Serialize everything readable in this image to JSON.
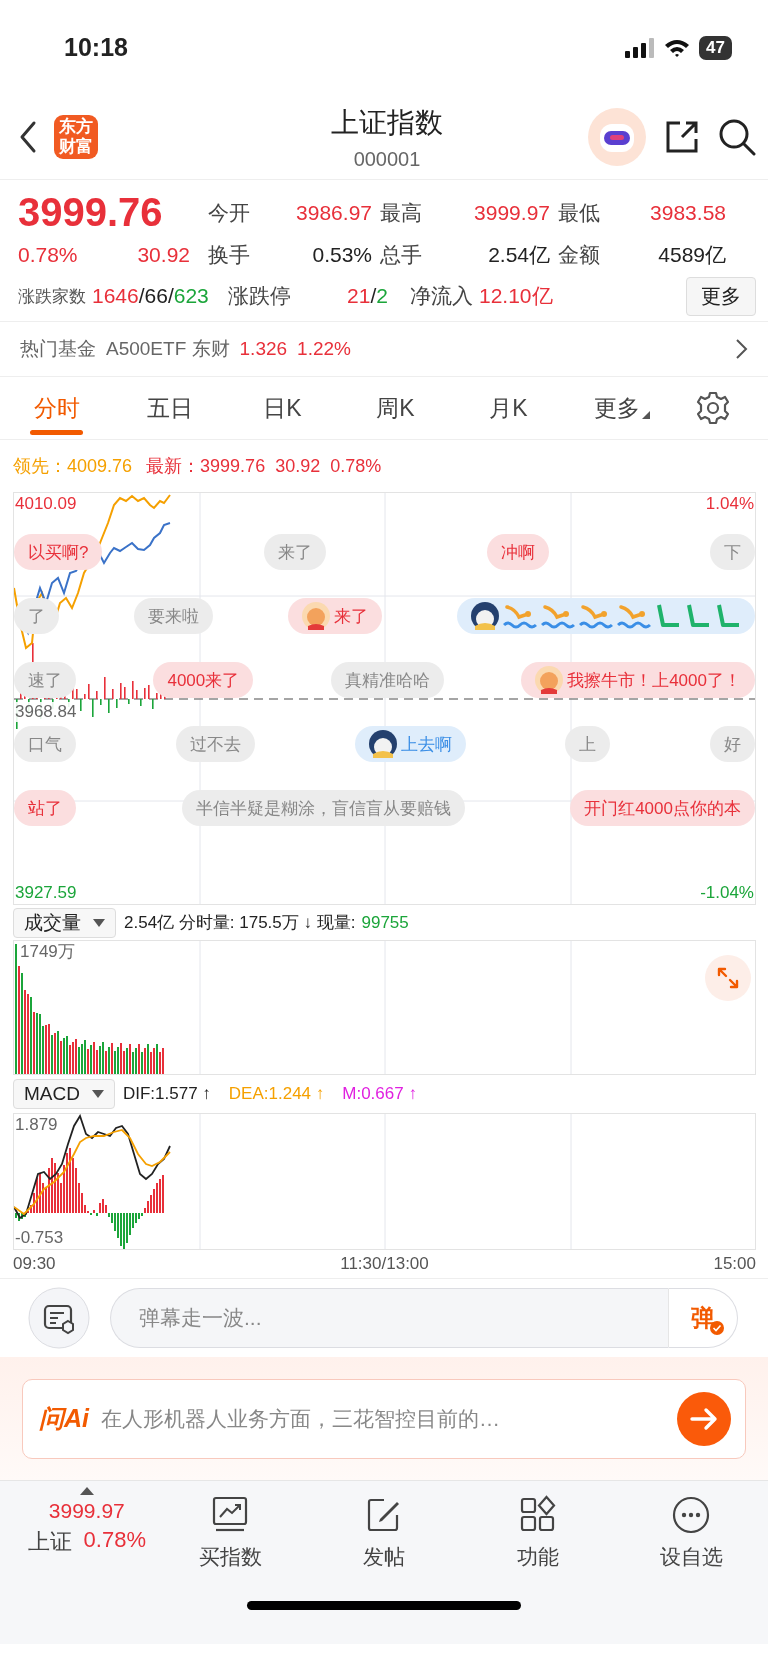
{
  "status_bar": {
    "time": "10:18",
    "battery": "47"
  },
  "header": {
    "logo": "东方财富",
    "title": "上证指数",
    "code": "000001"
  },
  "quote": {
    "price": "3999.76",
    "change_pct": "0.78%",
    "change": "30.92",
    "color": "#e8303a",
    "stats": [
      {
        "label": "今开",
        "value": "3986.97",
        "color": "#e8303a"
      },
      {
        "label": "最高",
        "value": "3999.97",
        "color": "#e8303a"
      },
      {
        "label": "最低",
        "value": "3983.58",
        "color": "#e8303a"
      },
      {
        "label": "换手",
        "value": "0.53%",
        "color": "#222222"
      },
      {
        "label": "总手",
        "value": "2.54亿",
        "color": "#222222"
      },
      {
        "label": "金额",
        "value": "4589亿",
        "color": "#222222"
      }
    ],
    "breadth": {
      "label": "涨跌家数",
      "parts": [
        {
          "text": "1646",
          "color": "#e8303a"
        },
        {
          "text": "/",
          "color": "#222222"
        },
        {
          "text": "66",
          "color": "#222222"
        },
        {
          "text": "/",
          "color": "#222222"
        },
        {
          "text": "623",
          "color": "#1ba53a"
        }
      ]
    },
    "limits": {
      "label": "涨跌停",
      "parts": [
        {
          "text": "21",
          "color": "#e8303a"
        },
        {
          "text": "/",
          "color": "#222222"
        },
        {
          "text": "2",
          "color": "#1ba53a"
        }
      ]
    },
    "inflow": {
      "label": "净流入",
      "value": "12.10亿",
      "color": "#e8303a"
    },
    "more_button": "更多"
  },
  "hot_fund": {
    "label": "热门基金",
    "name": "A500ETF 东财",
    "price": "1.326",
    "change_pct": "1.22%",
    "color": "#e8303a"
  },
  "tabs": [
    {
      "label": "分时",
      "selected": true
    },
    {
      "label": "五日",
      "selected": false
    },
    {
      "label": "日K",
      "selected": false
    },
    {
      "label": "周K",
      "selected": false
    },
    {
      "label": "月K",
      "selected": false
    },
    {
      "label": "更多",
      "selected": false,
      "kind": "menu"
    }
  ],
  "legend": [
    {
      "text": "领先：4009.76",
      "color": "#f5a000"
    },
    {
      "text": "最新：3999.76  30.92  0.78%",
      "color": "#e8303a"
    }
  ],
  "price_chart": {
    "labels": [
      {
        "text": "4010.09",
        "kind": "high"
      },
      {
        "text": "1.04%",
        "kind": "high_pct"
      },
      {
        "text": "3968.84",
        "kind": "prev_close"
      },
      {
        "text": "3927.59",
        "kind": "low"
      },
      {
        "text": "-1.04%",
        "kind": "low_pct"
      }
    ]
  },
  "danmaku": [
    [
      {
        "text": "以买啊?",
        "color": "#e8303a",
        "avatar": false
      },
      {
        "text": "来了",
        "color": "#888888",
        "avatar": false
      },
      {
        "text": "冲啊",
        "color": "#e8303a",
        "avatar": false
      },
      {
        "text": "下",
        "color": "#888888",
        "avatar": false
      }
    ],
    [
      {
        "text": "了",
        "color": "#888888",
        "avatar": false
      },
      {
        "text": "要来啦",
        "color": "#888888",
        "avatar": false
      },
      {
        "text": "来了",
        "color": "#e8303a",
        "avatar": true
      },
      {
        "kind": "emoji",
        "color": "#3a8ee6",
        "avatar": true
      }
    ],
    [
      {
        "text": "速了",
        "color": "#888888",
        "avatar": false
      },
      {
        "text": "4000来了",
        "color": "#e8303a",
        "avatar": false
      },
      {
        "text": "真精准哈哈",
        "color": "#888888",
        "avatar": false
      },
      {
        "text": "我擦牛市！上4000了！",
        "color": "#e8303a",
        "avatar": true
      }
    ],
    [
      {
        "text": "口气",
        "color": "#888888",
        "avatar": false
      },
      {
        "text": "过不去",
        "color": "#888888",
        "avatar": false
      },
      {
        "text": "上去啊",
        "color": "#3a8ee6",
        "avatar": true
      },
      {
        "text": "上",
        "color": "#888888",
        "avatar": false
      },
      {
        "text": "好",
        "color": "#888888",
        "avatar": false
      }
    ],
    [
      {
        "text": "站了",
        "color": "#e8303a",
        "avatar": false
      },
      {
        "text": "半信半疑是糊涂，盲信盲从要赔钱",
        "color": "#888888",
        "avatar": false
      },
      {
        "text": "开门红4000点你的本",
        "color": "#e8303a",
        "avatar": false
      }
    ]
  ],
  "volume": {
    "selector": "成交量",
    "summary": "2.54亿 分时量: 175.5万 ↓ 现量:",
    "current": "99755",
    "max_label": "1749万"
  },
  "macd": {
    "selector": "MACD",
    "indicators": [
      {
        "text": "DIF:1.577 ↑",
        "color": "#222222"
      },
      {
        "text": "DEA:1.244 ↑",
        "color": "#f5a000"
      },
      {
        "text": "M:0.667 ↑",
        "color": "#e020e0"
      }
    ],
    "max_label": "1.879",
    "min_label": "-0.753"
  },
  "time_axis": [
    "09:30",
    "11:30/13:00",
    "15:00"
  ],
  "comment_bar": {
    "placeholder": "弹幕走一波...",
    "send": "弹"
  },
  "ai_bar": {
    "logo": "问Ai",
    "placeholder": "在人形机器人业务方面，三花智控目前的…"
  },
  "bottom_bar": {
    "quote": {
      "price": "3999.97",
      "name": "上证",
      "change_pct": "0.78%",
      "color": "#e8303a"
    },
    "items": [
      {
        "label": "买指数",
        "kind": "chart"
      },
      {
        "label": "发帖",
        "kind": "post"
      },
      {
        "label": "功能",
        "kind": "apps"
      },
      {
        "label": "设自选",
        "kind": "more"
      }
    ]
  }
}
